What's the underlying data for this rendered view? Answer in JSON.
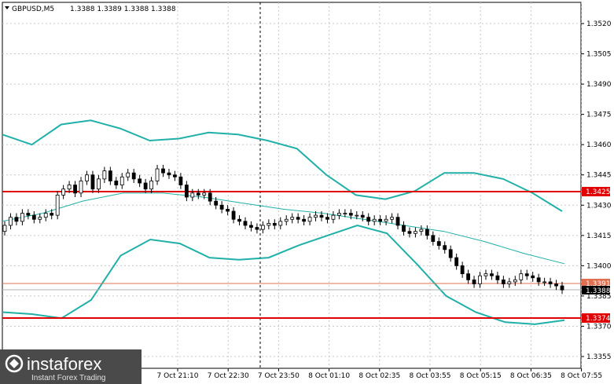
{
  "header": {
    "symbol": "GBPUSD,M5",
    "ohlc": "1.3388 1.3389 1.3388 1.3388"
  },
  "price_axis": {
    "ticks": [
      "1.3520",
      "1.3505",
      "1.3490",
      "1.3475",
      "1.3460",
      "1.3445",
      "1.3430",
      "1.3415",
      "1.3400",
      "1.3385",
      "1.3370",
      "1.3355"
    ]
  },
  "time_axis": {
    "ticks": [
      "7 Oct 21:10",
      "7 Oct 22:30",
      "7 Oct 23:50",
      "8 Oct 01:10",
      "8 Oct 02:35",
      "8 Oct 03:55",
      "8 Oct 05:15",
      "8 Oct 06:35",
      "8 Oct 07:55"
    ]
  },
  "levels": {
    "resistance": "1.3425",
    "current_marker": "1.3391",
    "bid": "1.3388",
    "support": "1.3374"
  },
  "colors": {
    "level_line": "#e00000",
    "bands": "#20b0a8",
    "candle": "#000000",
    "bid_label_bg": "#000000",
    "logo_bg": "#4a4a4a"
  },
  "logo": {
    "name": "instaforex",
    "tagline": "Instant Forex Trading",
    "icon": "instaforex-logo-icon"
  },
  "chart_data": {
    "type": "candlestick",
    "symbol": "GBPUSD",
    "timeframe": "M5",
    "ylim": [
      1.3348,
      1.353
    ],
    "horizontal_levels": [
      1.3425,
      1.3374
    ],
    "candles_close": [
      1.342,
      1.3424,
      1.3422,
      1.3426,
      1.3425,
      1.3423,
      1.3424,
      1.3426,
      1.3425,
      1.3435,
      1.3438,
      1.344,
      1.3436,
      1.3442,
      1.3445,
      1.3438,
      1.3443,
      1.3447,
      1.3442,
      1.344,
      1.3444,
      1.3446,
      1.3443,
      1.3441,
      1.3438,
      1.3442,
      1.3448,
      1.3446,
      1.3445,
      1.3444,
      1.344,
      1.3434,
      1.3436,
      1.3435,
      1.3436,
      1.3432,
      1.343,
      1.3428,
      1.3427,
      1.3423,
      1.3422,
      1.342,
      1.3419,
      1.3418,
      1.342,
      1.3421,
      1.342,
      1.3422,
      1.3423,
      1.3424,
      1.3423,
      1.3422,
      1.3424,
      1.3425,
      1.3424,
      1.3423,
      1.3425,
      1.3426,
      1.3426,
      1.3425,
      1.3425,
      1.3424,
      1.3422,
      1.3423,
      1.3422,
      1.3423,
      1.3424,
      1.342,
      1.3417,
      1.3416,
      1.3417,
      1.3418,
      1.3415,
      1.3412,
      1.341,
      1.3408,
      1.3404,
      1.34,
      1.3396,
      1.3393,
      1.3391,
      1.3395,
      1.3396,
      1.3395,
      1.3393,
      1.3391,
      1.3392,
      1.3393,
      1.3396,
      1.3395,
      1.3394,
      1.3392,
      1.3392,
      1.3391,
      1.339,
      1.3388
    ],
    "bands_upper": [
      1.3465,
      1.346,
      1.347,
      1.3472,
      1.3468,
      1.3462,
      1.3463,
      1.3466,
      1.3465,
      1.3462,
      1.3458,
      1.3445,
      1.3435,
      1.3433,
      1.3437,
      1.3446,
      1.3446,
      1.3443,
      1.3436,
      1.3427
    ],
    "bands_middle": [
      1.3422,
      1.3426,
      1.3432,
      1.3436,
      1.3436,
      1.3434,
      1.3431,
      1.3428,
      1.3426,
      1.3423,
      1.342,
      1.3417,
      1.3412,
      1.3406,
      1.3401
    ],
    "bands_lower": [
      1.3377,
      1.3376,
      1.3374,
      1.3383,
      1.3405,
      1.3413,
      1.3411,
      1.3404,
      1.3403,
      1.3404,
      1.341,
      1.3415,
      1.342,
      1.3416,
      1.3401,
      1.3385,
      1.3377,
      1.3372,
      1.3371,
      1.3373
    ]
  }
}
